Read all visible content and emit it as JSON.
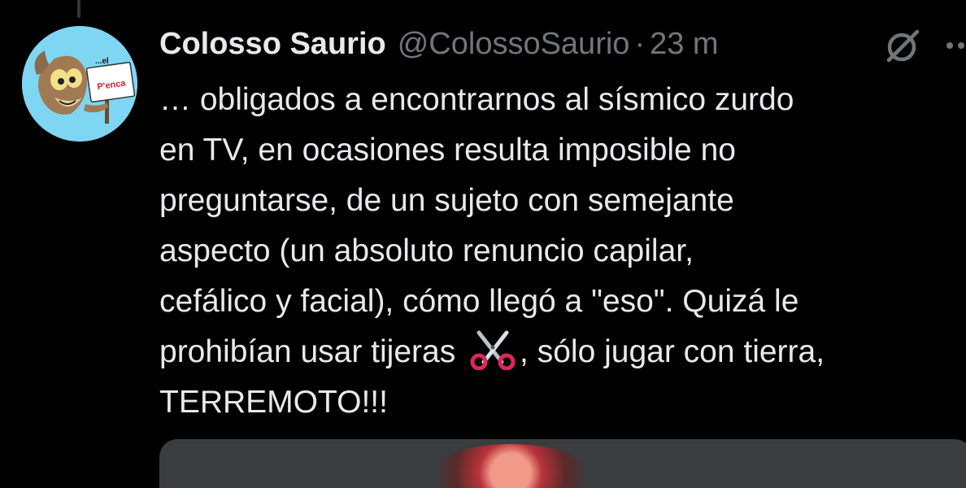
{
  "author": {
    "display_name": "Colosso Saurio",
    "handle": "@ColossoSaurio",
    "separator": "·",
    "time": "23 m",
    "avatar_text_top": "...el",
    "avatar_text_sign": "P'enca"
  },
  "tweet": {
    "text_before_emoji": "… obligados a encontrarnos al sísmico zurdo\nen TV, en ocasiones resulta imposible no\npreguntarse, de un sujeto con semejante\naspecto (un absoluto renuncio capilar,\ncefálico y facial), cómo llegó a \"eso\". Quizá le\nprohibían usar tijeras ",
    "emoji": "scissors",
    "text_after_emoji": ", sólo jugar con tierra,\nTERREMOTO!!!"
  },
  "icons": {
    "grok": "grok-icon",
    "more": "more-icon"
  },
  "colors": {
    "background": "#000000",
    "primary_text": "#e7e9ea",
    "secondary_text": "#71767b",
    "avatar_bg": "#7fd6f3"
  }
}
